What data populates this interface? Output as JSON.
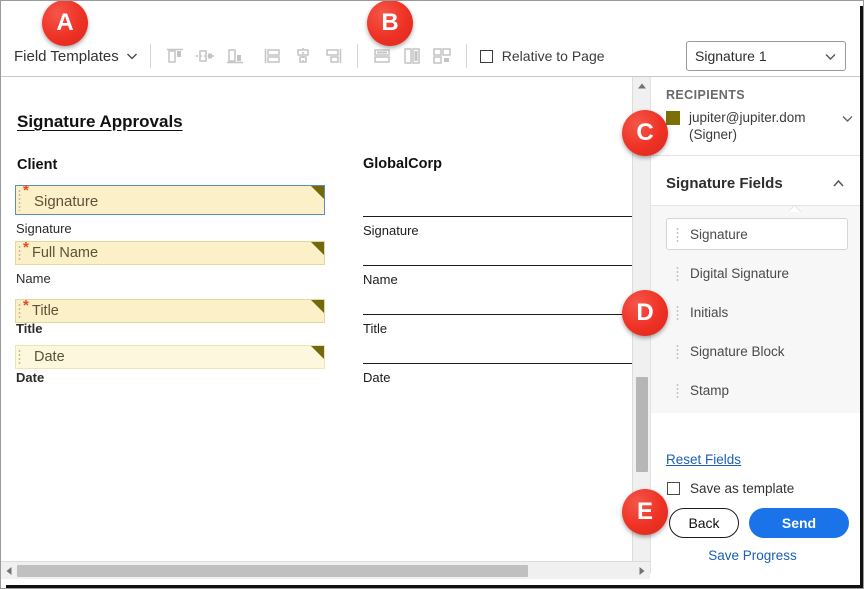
{
  "toolbar": {
    "field_templates_label": "Field Templates",
    "field_templates_icon": "chevron-down-icon",
    "align_icons": [
      {
        "name": "align-top-icon"
      },
      {
        "name": "align-middle-icon"
      },
      {
        "name": "align-bottom-icon"
      },
      {
        "name": "align-left-icon"
      },
      {
        "name": "align-center-icon"
      },
      {
        "name": "align-right-icon"
      },
      {
        "name": "same-width-icon"
      },
      {
        "name": "same-height-icon"
      },
      {
        "name": "same-size-icon"
      }
    ],
    "relative_to_page_label": "Relative to Page",
    "relative_to_page_checked": false,
    "signature_select_value": "Signature 1",
    "signature_select_icon": "chevron-down-icon"
  },
  "document": {
    "title": "Signature Approvals",
    "left_column_header": "Client",
    "right_column_header": "GlobalCorp",
    "fields": [
      {
        "text": "Signature",
        "caption": "Signature",
        "required": true,
        "selected": true,
        "light": false,
        "caption_bold": false
      },
      {
        "text": "Full Name",
        "caption": "Name",
        "required": true,
        "selected": false,
        "light": false,
        "caption_bold": false
      },
      {
        "text": "Title",
        "caption": "Title",
        "required": true,
        "selected": false,
        "light": false,
        "caption_bold": true
      },
      {
        "text": "Date",
        "caption": "Date",
        "required": false,
        "selected": false,
        "light": true,
        "caption_bold": true
      }
    ],
    "right_lines": [
      "Signature",
      "Name",
      "Title",
      "Date"
    ]
  },
  "panel": {
    "recipients_header": "RECIPIENTS",
    "recipient_name": "jupiter@jupiter.dom (Signer)",
    "recipient_color": "#7b6f0a",
    "recipient_chevron_icon": "chevron-down-icon",
    "section_title": "Signature Fields",
    "section_chevron_icon": "chevron-up-icon",
    "field_items": [
      {
        "label": "Signature",
        "active": true
      },
      {
        "label": "Digital Signature",
        "active": false
      },
      {
        "label": "Initials",
        "active": false
      },
      {
        "label": "Signature Block",
        "active": false
      },
      {
        "label": "Stamp",
        "active": false
      }
    ],
    "reset_fields_label": "Reset Fields",
    "save_template_label": "Save as template",
    "save_template_checked": false,
    "back_label": "Back",
    "send_label": "Send",
    "save_progress_label": "Save Progress"
  },
  "badges": [
    {
      "letter": "A"
    },
    {
      "letter": "B"
    },
    {
      "letter": "C"
    },
    {
      "letter": "D"
    },
    {
      "letter": "E"
    }
  ],
  "colors": {
    "badge_red": "#ee3124",
    "send_blue": "#1a73e8",
    "link_blue": "#1a5fb4",
    "field_yellow": "#fbf0c8",
    "field_corner": "#73680c"
  }
}
